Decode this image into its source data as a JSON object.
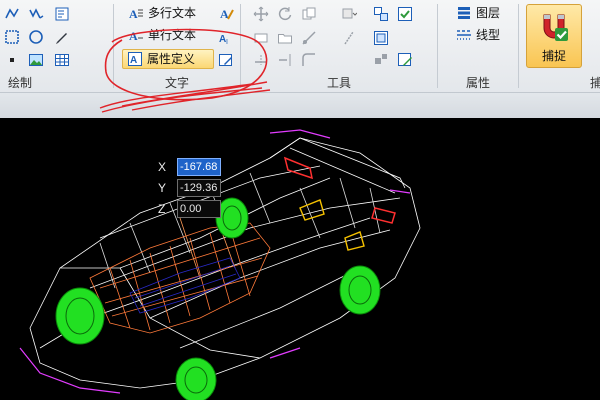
{
  "ribbon": {
    "groups": {
      "draw": {
        "label": "绘制"
      },
      "text": {
        "label": "文字",
        "items": {
          "multiline": "多行文本",
          "singleline": "单行文本",
          "attribute_def": "属性定义"
        }
      },
      "tools": {
        "label": "工具"
      },
      "properties": {
        "label": "属性",
        "items": {
          "layer": "图层",
          "linetype": "线型"
        }
      },
      "snap": {
        "label": "捕捉"
      }
    },
    "partial_group_label": "捕"
  },
  "canvas": {
    "background": "#000000",
    "coord_input": {
      "x": {
        "axis": "X",
        "value": "-167.68"
      },
      "y": {
        "axis": "Y",
        "value": "-129.36"
      },
      "z": {
        "axis": "Z",
        "value": "0.00"
      }
    }
  },
  "colors": {
    "wireframe_white": "#ffffff",
    "wireframe_orange": "#ff7a3a",
    "wheel_green": "#22e022",
    "accent_magenta": "#e23cff",
    "interior_blue": "#2a2ac8",
    "annotation_red": "#e0242a",
    "highlight_gold": "#fbd774",
    "active_field": "#1f63c9"
  }
}
